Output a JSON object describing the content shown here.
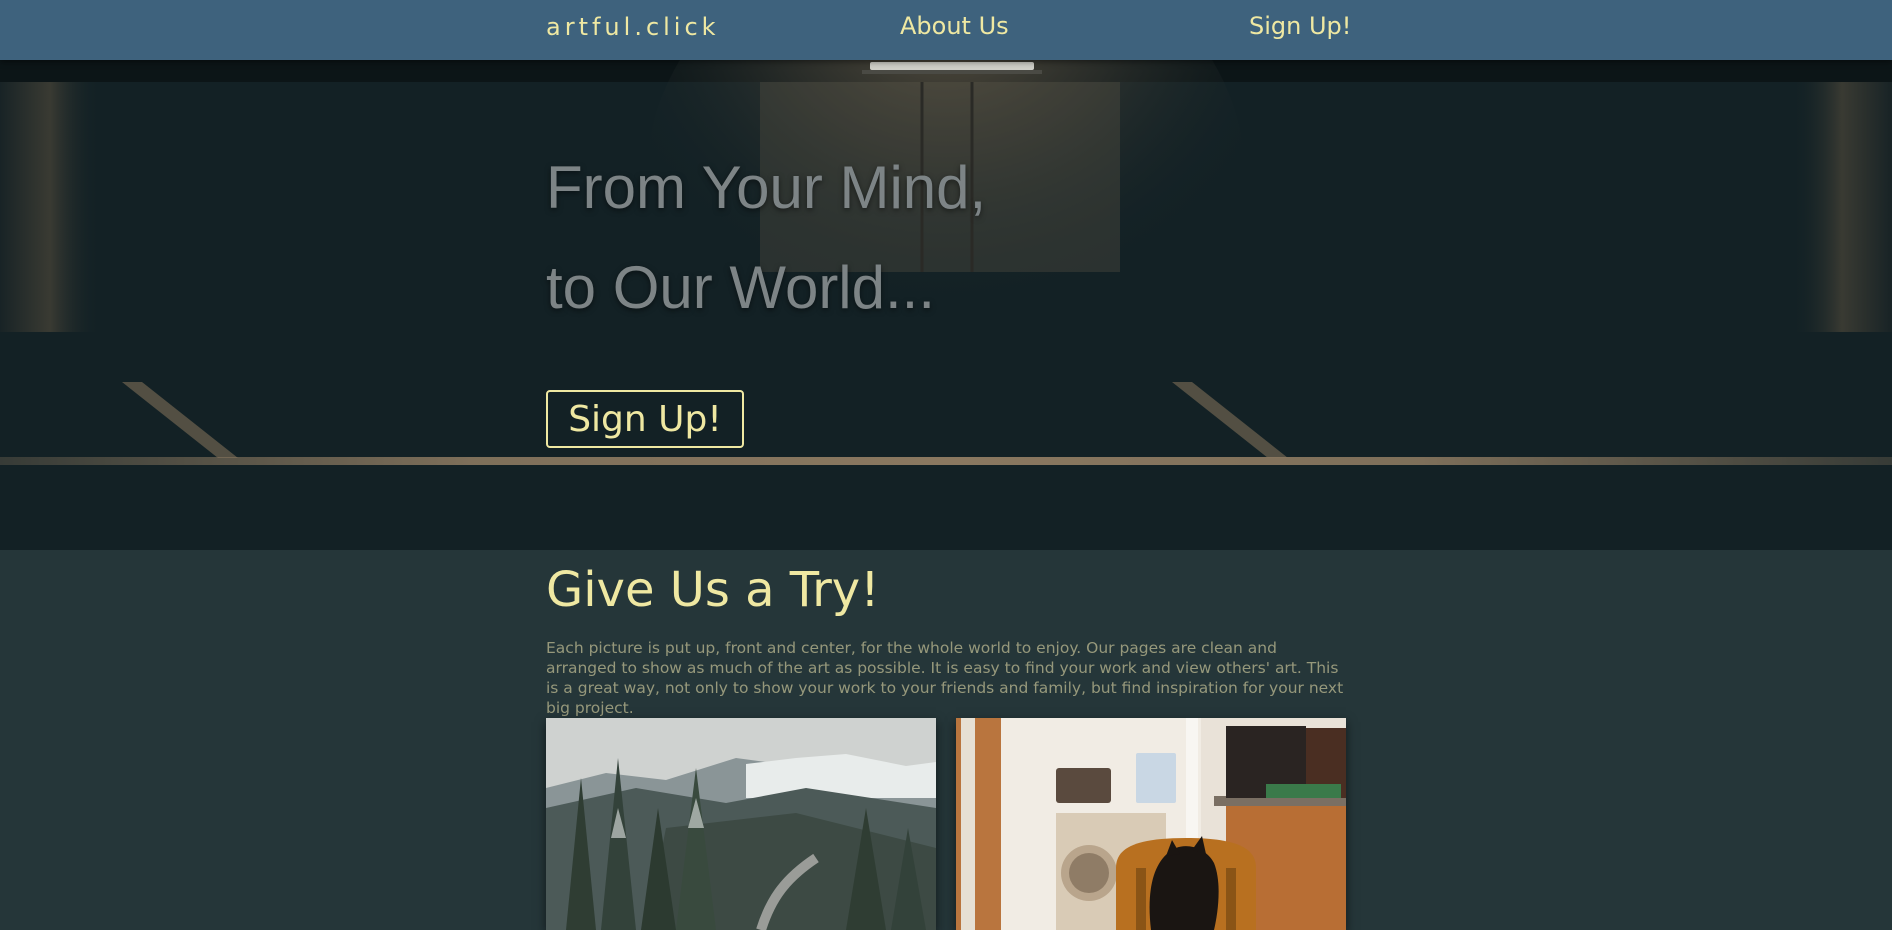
{
  "nav": {
    "logo": "artful.click",
    "about_label": "About Us",
    "signup_label": "Sign Up!"
  },
  "hero": {
    "line1": "From Your Mind,",
    "line2": "to Our World...",
    "button_label": "Sign Up!"
  },
  "intro": {
    "title": "Give Us a Try!",
    "body": "Each picture is put up, front and center, for the whole world to enjoy. Our pages are clean and arranged to show as much of the art as possible. It is easy to find your work and view others' art. This is a great way, not only to show your work to your friends and family, but find inspiration for your next big project."
  },
  "gallery": [
    {
      "subject": "mountain-road-photo"
    },
    {
      "subject": "cat-on-chair-photo"
    }
  ],
  "colors": {
    "navbar": "#3e627d",
    "accent_yellow": "#efe8a2",
    "hero_bg": "#132125",
    "section_bg": "#253639",
    "body_text": "#96987b"
  }
}
